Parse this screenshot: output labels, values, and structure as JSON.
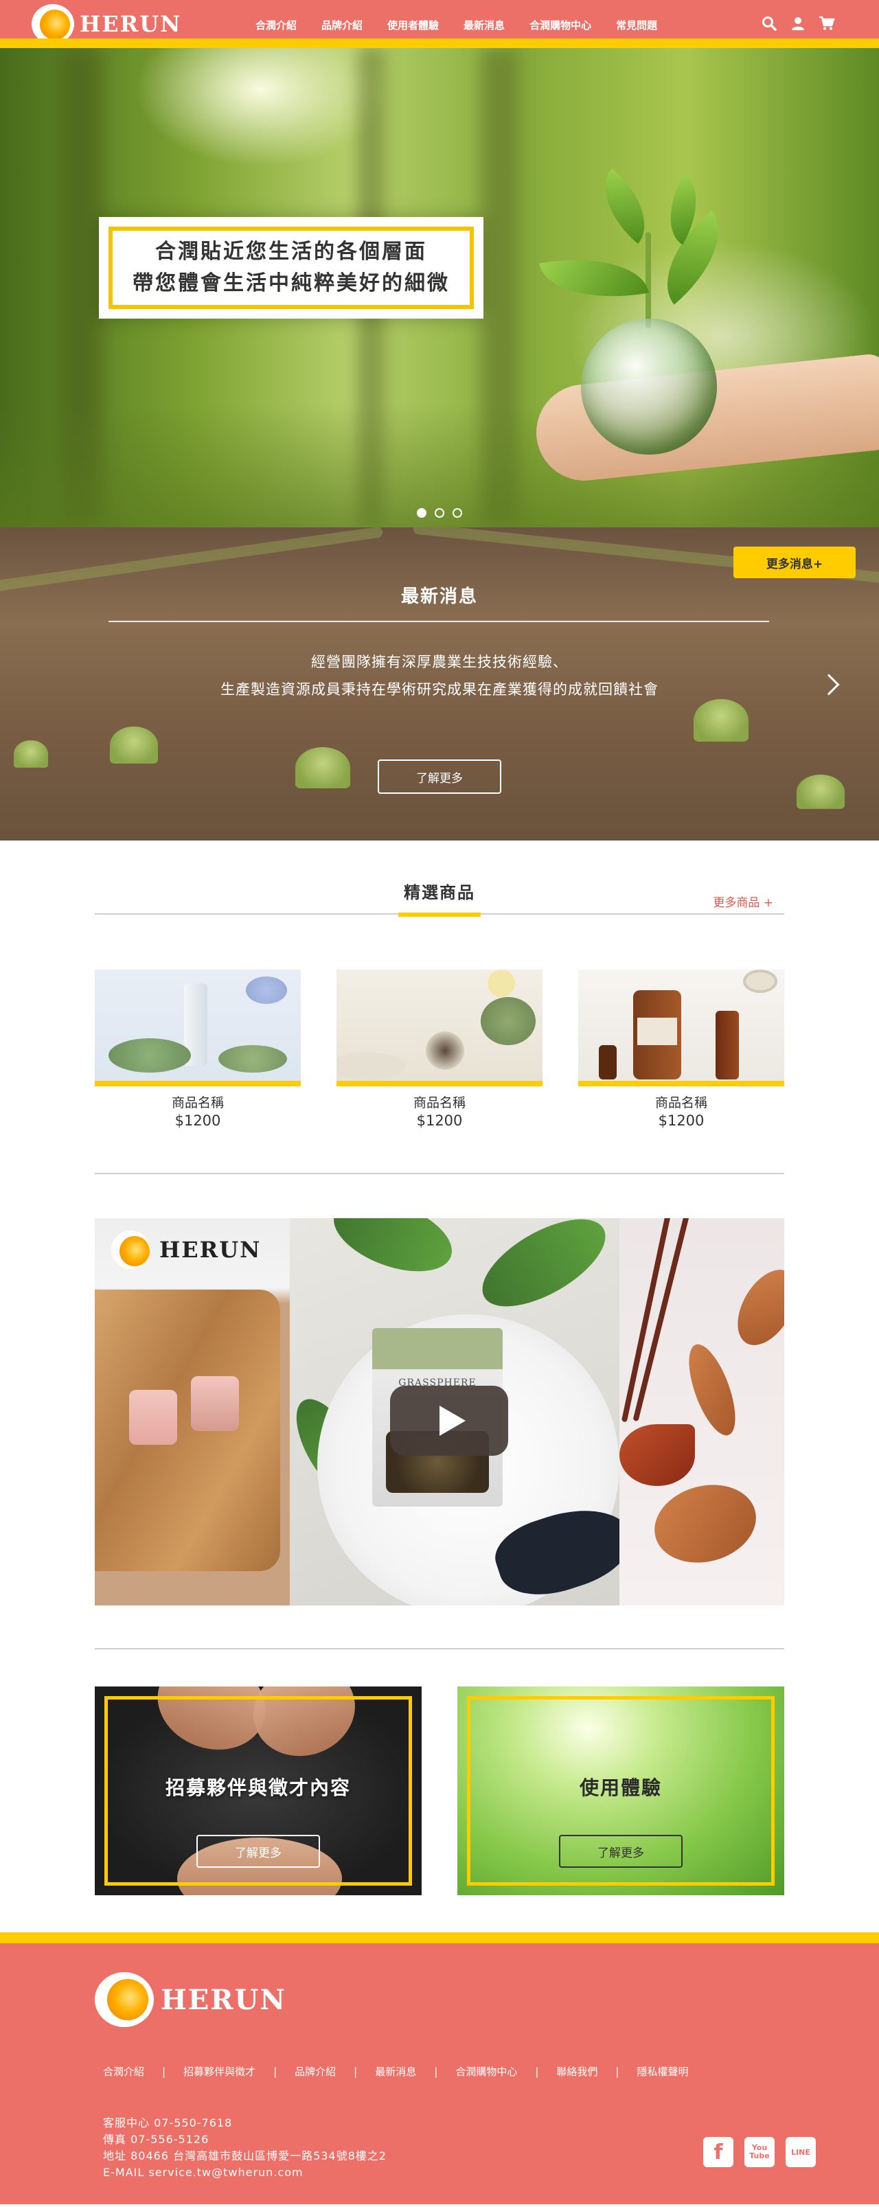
{
  "header": {
    "brand": "HERUN",
    "nav": [
      "合潤介紹",
      "品牌介紹",
      "使用者體驗",
      "最新消息",
      "合潤購物中心",
      "常見問題"
    ],
    "icons": [
      "search-icon",
      "user-icon",
      "cart-icon"
    ]
  },
  "hero": {
    "line1": "合潤貼近您生活的各個層面",
    "line2": "帶您體會生活中純粹美好的細微",
    "slides": 3,
    "active_slide": 1
  },
  "news": {
    "more_button": "更多消息+",
    "title": "最新消息",
    "text_line1": "經營團隊擁有深厚農業生技技術經驗、",
    "text_line2": "生產製造資源成員秉持在學術研究成果在產業獲得的成就回饋社會",
    "cta": "了解更多"
  },
  "featured": {
    "title": "精選商品",
    "more": "更多商品 +",
    "products": [
      {
        "name": "商品名稱",
        "price": "$1200"
      },
      {
        "name": "商品名稱",
        "price": "$1200"
      },
      {
        "name": "商品名稱",
        "price": "$1200"
      }
    ]
  },
  "video": {
    "brand": "HERUN",
    "bag_label": "GRASSPHERE"
  },
  "cards": [
    {
      "title": "招募夥伴與徵才內容",
      "cta": "了解更多"
    },
    {
      "title": "使用體驗",
      "cta": "了解更多"
    }
  ],
  "footer": {
    "brand": "HERUN",
    "nav": [
      "合潤介紹",
      "招募夥伴與徵才",
      "品牌介紹",
      "最新消息",
      "合潤購物中心",
      "聯絡我們",
      "隱私權聲明"
    ],
    "separator": "|",
    "contact": [
      "客服中心  07-550-7618",
      "傳真  07-556-5126",
      "地址  80466 台灣高雄市鼓山區博愛一路534號8樓之2",
      "E-MAIL  service.tw@twherun.com"
    ],
    "social": [
      "facebook-icon",
      "youtube-icon",
      "line-icon"
    ],
    "social_labels": [
      "f",
      "You Tube",
      "LINE"
    ]
  },
  "colors": {
    "brand": "#ec7067",
    "accent": "#ffcc00"
  }
}
